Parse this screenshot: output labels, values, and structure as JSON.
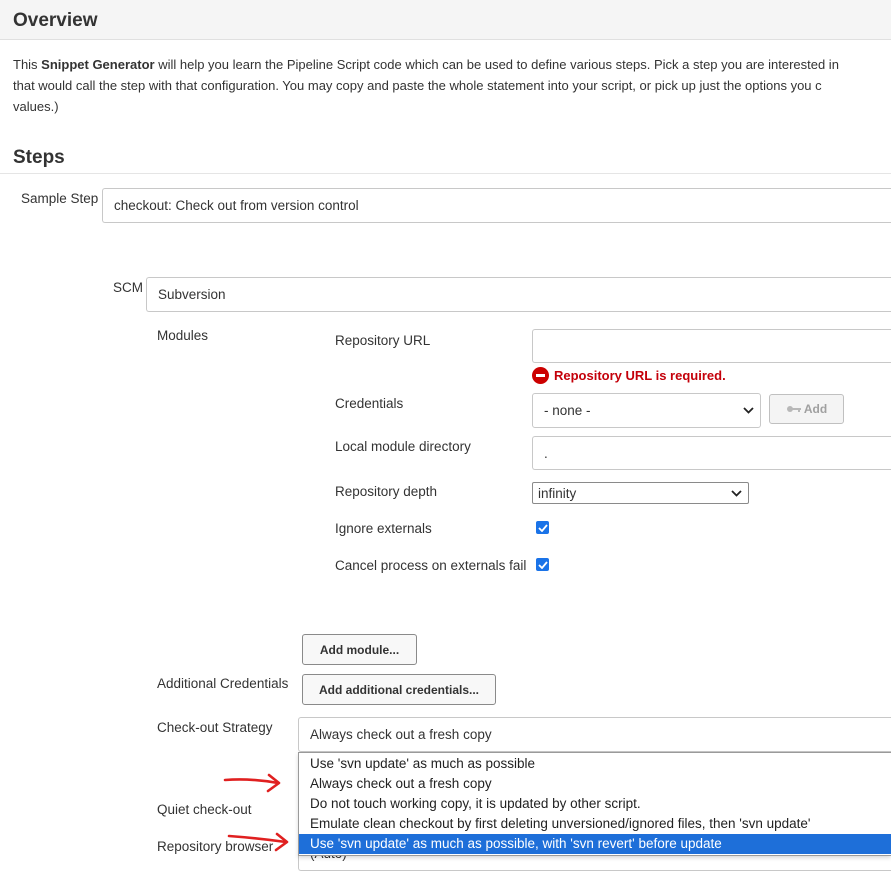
{
  "overview": {
    "title": "Overview",
    "line1_pre": "This ",
    "line1_bold": "Snippet Generator",
    "line1_post": " will help you learn the Pipeline Script code which can be used to define various steps. Pick a step you are interested in",
    "line2": "that would call the step with that configuration. You may copy and paste the whole statement into your script, or pick up just the options you c",
    "line3": "values.)"
  },
  "steps": {
    "title": "Steps",
    "sample_step_label": "Sample Step",
    "sample_step_value": "checkout: Check out from version control"
  },
  "scm": {
    "label": "SCM",
    "value": "Subversion"
  },
  "modules": {
    "label": "Modules",
    "repo_url_label": "Repository URL",
    "repo_url_value": "",
    "repo_url_error": "Repository URL is required.",
    "credentials_label": "Credentials",
    "credentials_value": "- none -",
    "add_label": "Add",
    "local_dir_label": "Local module directory",
    "local_dir_value": ".",
    "depth_label": "Repository depth",
    "depth_value": "infinity",
    "ignore_externals_label": "Ignore externals",
    "ignore_externals_checked": true,
    "cancel_externals_label": "Cancel process on externals fail",
    "cancel_externals_checked": true,
    "add_module_label": "Add module..."
  },
  "additional_credentials": {
    "label": "Additional Credentials",
    "button_label": "Add additional credentials..."
  },
  "checkout_strategy": {
    "label": "Check-out Strategy",
    "value": "Always check out a fresh copy",
    "options": [
      "Use 'svn update' as much as possible",
      "Always check out a fresh copy",
      "Do not touch working copy, it is updated by other script.",
      "Emulate clean checkout by first deleting unversioned/ignored files, then 'svn update'",
      "Use 'svn update' as much as possible, with 'svn revert' before update"
    ],
    "highlighted_index": 4
  },
  "quiet_checkout": {
    "label": "Quiet check-out"
  },
  "repository_browser": {
    "label": "Repository browser",
    "value": "(Auto)"
  },
  "colors": {
    "accent": "#1e6fd9",
    "error": "#c4000a",
    "annotation_arrow": "#e02020"
  }
}
